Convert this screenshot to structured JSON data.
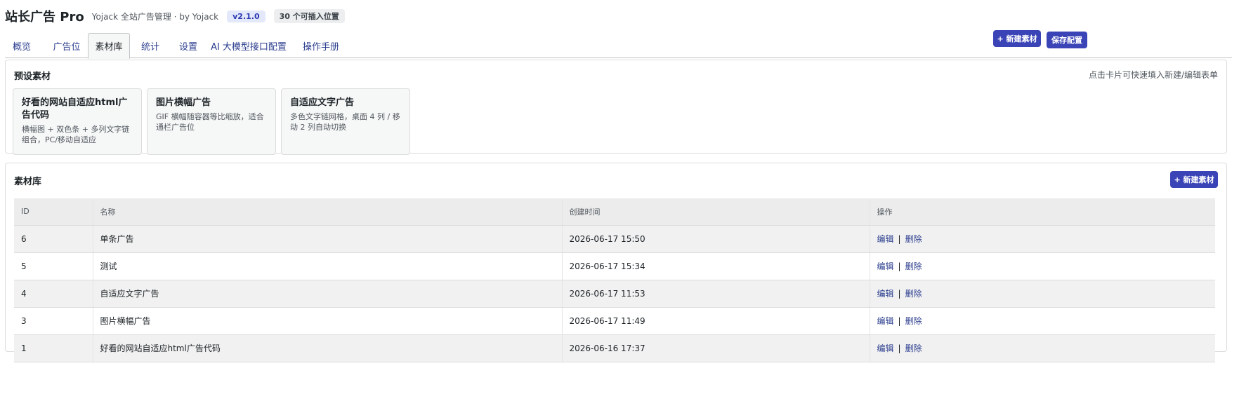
{
  "header": {
    "title": "站长广告 Pro",
    "subtitle": "Yojack 全站广告管理 · by Yojack",
    "version": "v2.1.0",
    "positions_badge": "30 个可插入位置"
  },
  "tabs": [
    {
      "label": "概览"
    },
    {
      "label": "广告位"
    },
    {
      "label": "素材库",
      "active": true
    },
    {
      "label": "统计"
    },
    {
      "label": "设置"
    },
    {
      "label": "AI 大模型接口配置"
    },
    {
      "label": "操作手册"
    }
  ],
  "toolbar": {
    "new_material": "+ 新建素材",
    "save_config": "保存配置"
  },
  "presets": {
    "title": "预设素材",
    "hint": "点击卡片可快速填入新建/编辑表单",
    "cards": [
      {
        "title": "好看的网站自适应html广告代码",
        "desc": "横幅图 + 双色条 + 多列文字链组合，PC/移动自适应"
      },
      {
        "title": "图片横幅广告",
        "desc": "GIF 横幅随容器等比缩放，适合通栏广告位"
      },
      {
        "title": "自适应文字广告",
        "desc": "多色文字链网格，桌面 4 列 / 移动 2 列自动切换"
      }
    ]
  },
  "library": {
    "title": "素材库",
    "new_button": "+ 新建素材",
    "columns": [
      "ID",
      "名称",
      "创建时间",
      "操作"
    ],
    "rows": [
      {
        "id": "6",
        "name": "单条广告",
        "created": "2026-06-17 15:50"
      },
      {
        "id": "5",
        "name": "测试",
        "created": "2026-06-17 15:34"
      },
      {
        "id": "4",
        "name": "自适应文字广告",
        "created": "2026-06-17 11:53"
      },
      {
        "id": "3",
        "name": "图片横幅广告",
        "created": "2026-06-17 11:49"
      },
      {
        "id": "1",
        "name": "好看的网站自适应html广告代码",
        "created": "2026-06-16 17:37"
      }
    ],
    "edit_label": "编辑",
    "separator": "|",
    "delete_label": "删除"
  },
  "colors": {
    "accent": "#3a44b6",
    "link": "#2c3e8f"
  }
}
